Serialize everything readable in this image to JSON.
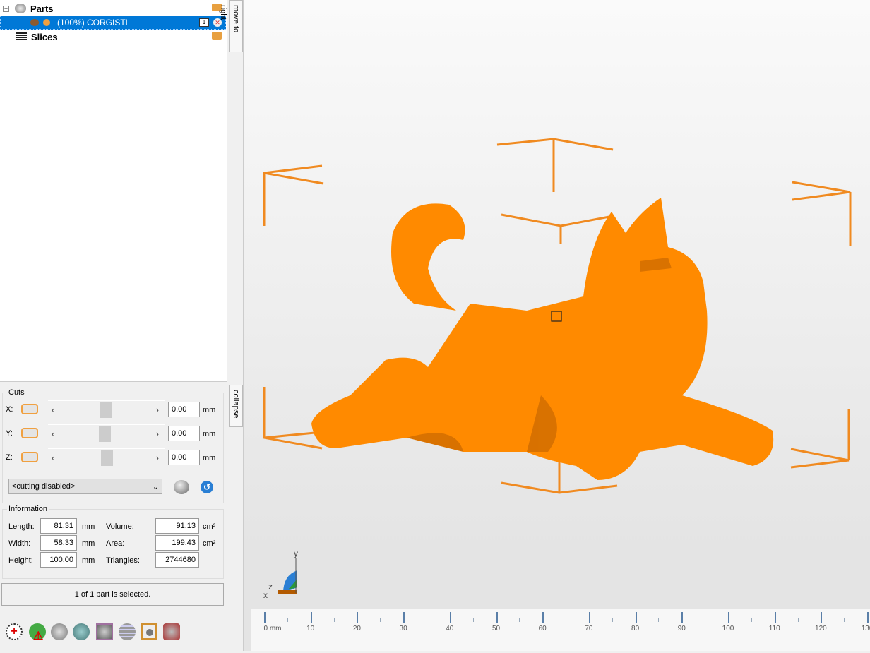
{
  "tree": {
    "parts_label": "Parts",
    "part_name": "(100%) CORGISTL",
    "part_count": "1",
    "slices_label": "Slices"
  },
  "side_tabs": {
    "move": "move to right",
    "collapse": "collapse"
  },
  "cuts": {
    "title": "Cuts",
    "axes": [
      {
        "label": "X:",
        "value": "0.00",
        "unit": "mm"
      },
      {
        "label": "Y:",
        "value": "0.00",
        "unit": "mm"
      },
      {
        "label": "Z:",
        "value": "0.00",
        "unit": "mm"
      }
    ],
    "mode": "<cutting disabled>"
  },
  "info": {
    "title": "Information",
    "length_label": "Length:",
    "length": "81.31",
    "width_label": "Width:",
    "width": "58.33",
    "height_label": "Height:",
    "height": "100.00",
    "mm": "mm",
    "volume_label": "Volume:",
    "volume": "91.13",
    "area_label": "Area:",
    "area": "199.43",
    "cm3": "cm³",
    "cm2": "cm²",
    "tri_label": "Triangles:",
    "triangles": "2744680"
  },
  "status": "1 of 1 part is selected.",
  "ruler": {
    "labels": [
      "0 mm",
      "10",
      "20",
      "30",
      "40",
      "50",
      "60",
      "70",
      "80",
      "90",
      "100",
      "110",
      "120",
      "130"
    ]
  },
  "axes_gizmo": {
    "x": "x",
    "y": "y",
    "z": "z"
  },
  "colors": {
    "model": "#ff8a00",
    "selection": "#0078d7"
  }
}
